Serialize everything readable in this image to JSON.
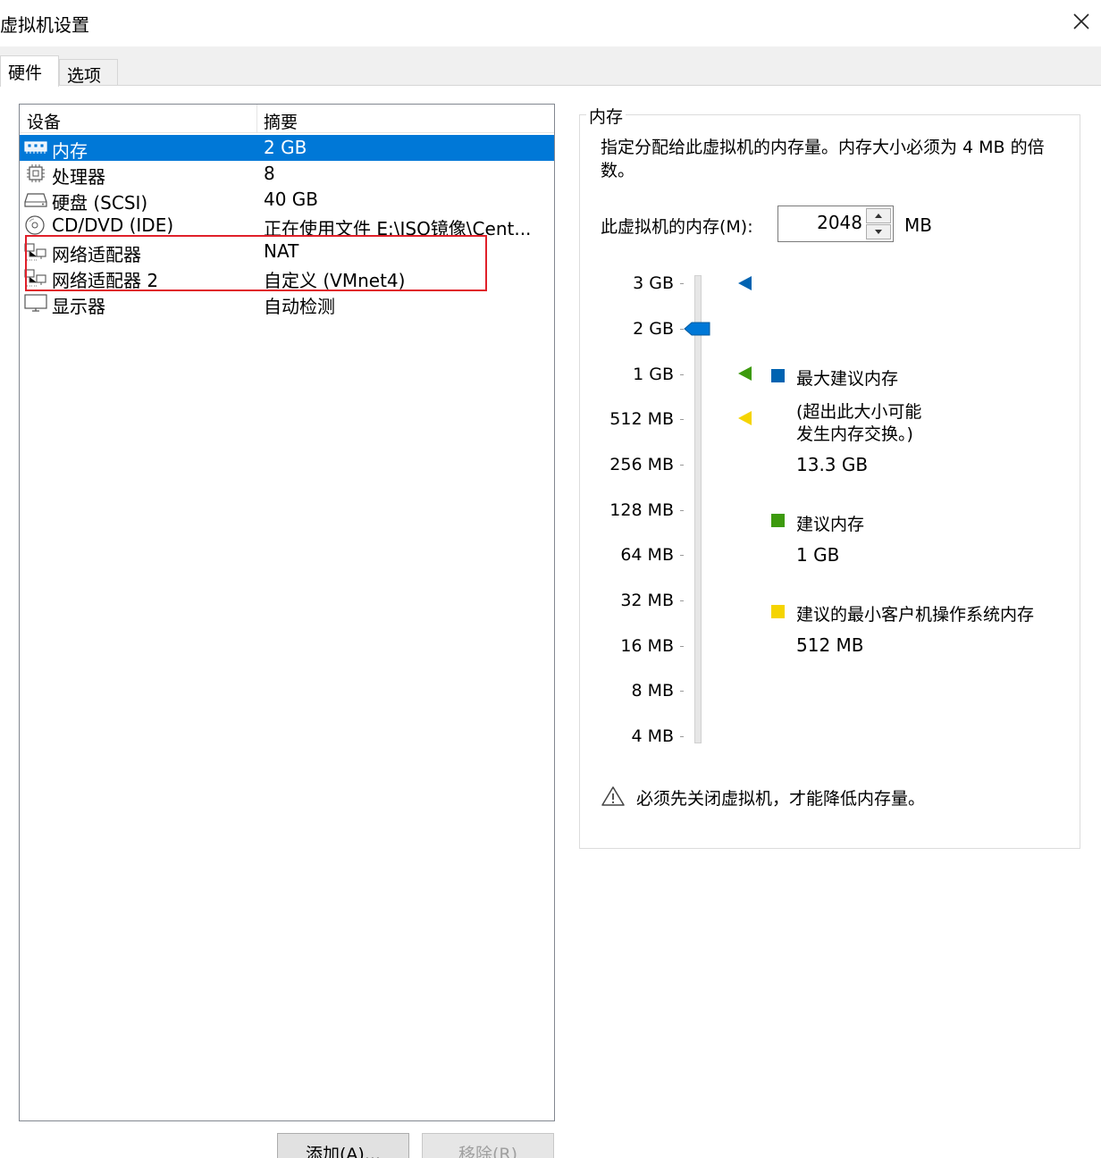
{
  "window": {
    "title": "虚拟机设置"
  },
  "tabs": [
    {
      "label": "硬件",
      "active": true
    },
    {
      "label": "选项",
      "active": false
    }
  ],
  "device_list": {
    "headers": {
      "device": "设备",
      "summary": "摘要"
    },
    "rows": [
      {
        "name": "内存",
        "summary": "2 GB",
        "icon": "memory-icon",
        "selected": true
      },
      {
        "name": "处理器",
        "summary": "8",
        "icon": "processor-icon",
        "selected": false
      },
      {
        "name": "硬盘 (SCSI)",
        "summary": "40 GB",
        "icon": "harddisk-icon",
        "selected": false
      },
      {
        "name": "CD/DVD (IDE)",
        "summary": "正在使用文件 E:\\ISO镜像\\Cent...",
        "icon": "cd-dvd-icon",
        "selected": false
      },
      {
        "name": "网络适配器",
        "summary": "NAT",
        "icon": "network-adapter-icon",
        "selected": false
      },
      {
        "name": "网络适配器 2",
        "summary": "自定义 (VMnet4)",
        "icon": "network-adapter-icon",
        "selected": false
      },
      {
        "name": "显示器",
        "summary": "自动检测",
        "icon": "display-icon",
        "selected": false
      }
    ]
  },
  "buttons": {
    "add": "添加(A)...",
    "remove": "移除(R)"
  },
  "memory": {
    "group_title": "内存",
    "description": "指定分配给此虚拟机的内存量。内存大小必须为 4 MB 的倍数。",
    "label": "此虚拟机的内存(M):",
    "value": "2048",
    "unit": "MB",
    "scale": [
      "3 GB",
      "2 GB",
      "1 GB",
      "512 MB",
      "256 MB",
      "128 MB",
      "64 MB",
      "32 MB",
      "16 MB",
      "8 MB",
      "4 MB"
    ],
    "slider_value": "2 GB",
    "legend": {
      "max_recommended": {
        "title": "最大建议内存",
        "note_line1": "(超出此大小可能",
        "note_line2": "发生内存交换。)",
        "value": "13.3 GB",
        "color": "#0063b1",
        "marker_at": "3 GB"
      },
      "recommended": {
        "title": "建议内存",
        "value": "1 GB",
        "color": "#3d9a0e",
        "marker_at": "1 GB"
      },
      "min_guest": {
        "title": "建议的最小客户机操作系统内存",
        "value": "512 MB",
        "color": "#f5d400",
        "marker_at": "512 MB"
      }
    },
    "warning": "必须先关闭虚拟机，才能降低内存量。"
  },
  "colors": {
    "selection": "#0078d7",
    "highlight_box": "#e0202a"
  }
}
